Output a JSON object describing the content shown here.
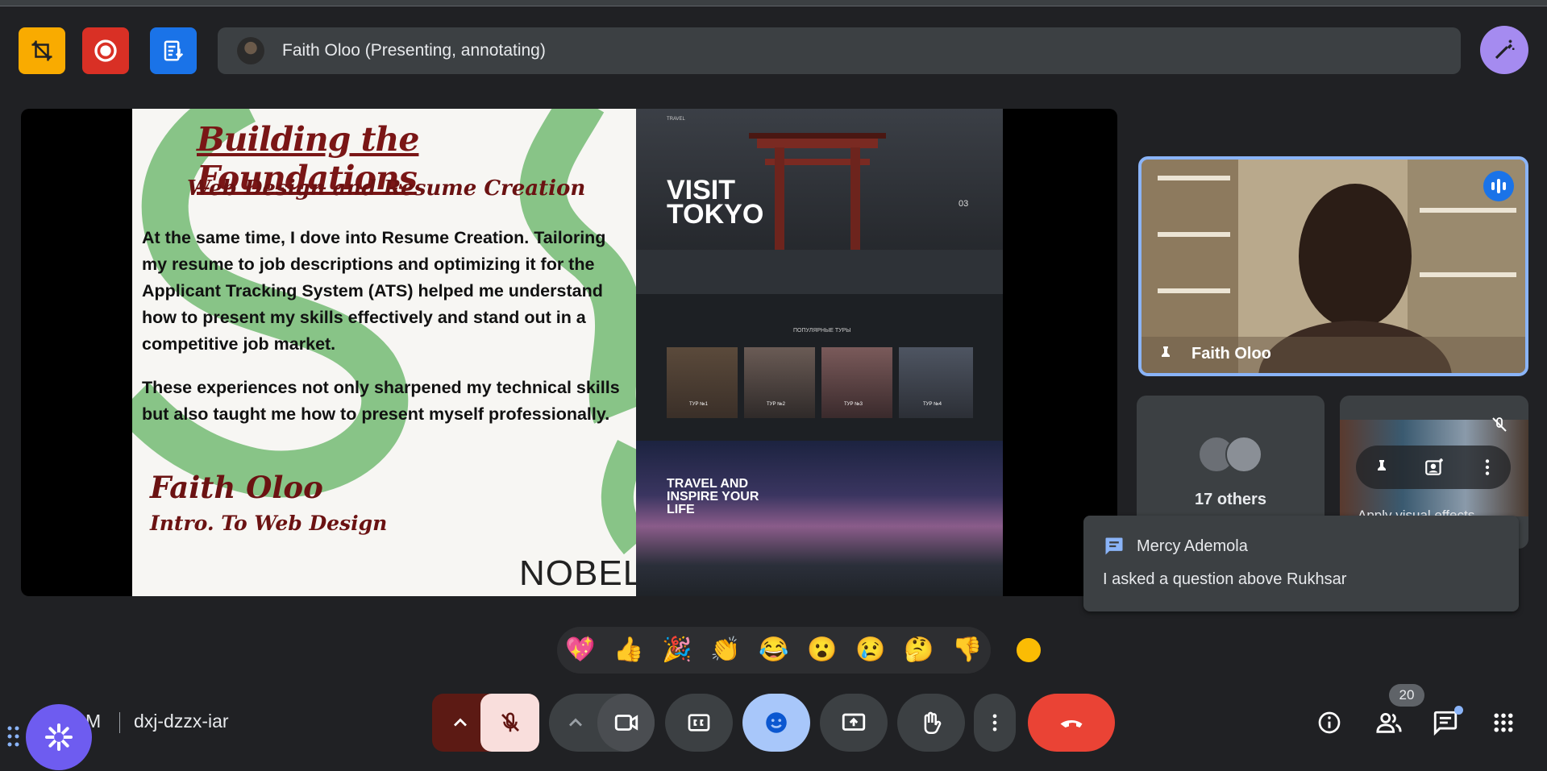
{
  "top_bar": {
    "presenter_label": "Faith Oloo (Presenting, annotating)",
    "chips": [
      {
        "name": "no-crop-icon",
        "color": "#f9ab00"
      },
      {
        "name": "record-icon",
        "color": "#d93025"
      },
      {
        "name": "transcript-icon",
        "color": "#1a73e8"
      }
    ],
    "magic_button_color": "#a58bf0"
  },
  "slide": {
    "title": "Building the Foundations",
    "subtitle": "Web Design and Resume Creation",
    "paragraph1": "At the same time, I dove into Resume Creation. Tailoring my resume to job descriptions and optimizing it for the Applicant Tracking System (ATS) helped me understand how to present my skills effectively and stand out in a competitive job market.",
    "paragraph2": "These experiences not only sharpened my technical skills but also taught me how to present myself professionally.",
    "author": "Faith Oloo",
    "course": "Intro. To Web Design",
    "logo": "NOBEL",
    "screenshot": {
      "brand": "TRAVEL",
      "hero": "VISIT\nTOKYO",
      "slide_number": "03",
      "section_title": "ПОПУЛЯРНЫЕ ТУРЫ",
      "tours": [
        "ТУР №1",
        "ТУР №2",
        "ТУР №3",
        "ТУР №4"
      ],
      "banner": "TRAVEL AND\nINSPIRE YOUR\nLIFE"
    }
  },
  "participants": {
    "main_tile_name": "Faith Oloo",
    "others_label": "17 others",
    "count_badge": "20"
  },
  "tooltip": "Apply visual effects",
  "chat_toast": {
    "sender": "Mercy Ademola",
    "message": "I asked a question above Rukhsar"
  },
  "reactions": [
    "💖",
    "👍",
    "🎉",
    "👏",
    "😂",
    "😮",
    "😢",
    "🤔",
    "👎"
  ],
  "bottom_bar": {
    "clock_fragment": "M",
    "meeting_code": "dxj-dzzx-iar"
  },
  "colors": {
    "accent_blue": "#8ab4f8",
    "leave_red": "#ea4335",
    "mic_off_bg": "#f9dedc",
    "emoji_active": "#a8c7fa"
  }
}
